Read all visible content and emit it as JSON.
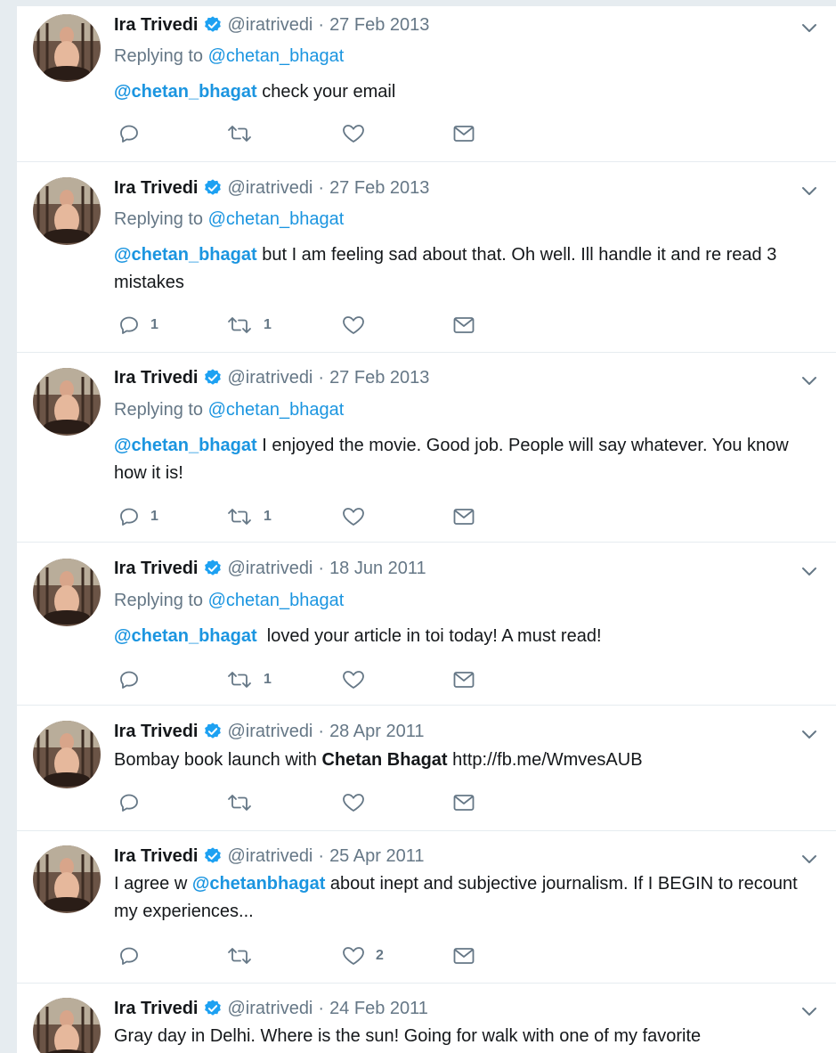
{
  "tweets": [
    {
      "name": "Ira Trivedi",
      "handle": "@iratrivedi",
      "date": "27 Feb 2013",
      "replying_prefix": "Replying to",
      "replying_to": "@chetan_bhagat",
      "mention": "@chetan_bhagat",
      "text": " check your email",
      "reply_count": "",
      "retweet_count": "",
      "like_count": ""
    },
    {
      "name": "Ira Trivedi",
      "handle": "@iratrivedi",
      "date": "27 Feb 2013",
      "replying_prefix": "Replying to",
      "replying_to": "@chetan_bhagat",
      "mention": "@chetan_bhagat",
      "text": " but I am feeling sad about that. Oh well. Ill handle it and re read 3 mistakes",
      "reply_count": "1",
      "retweet_count": "1",
      "like_count": ""
    },
    {
      "name": "Ira Trivedi",
      "handle": "@iratrivedi",
      "date": "27 Feb 2013",
      "replying_prefix": "Replying to",
      "replying_to": "@chetan_bhagat",
      "mention": "@chetan_bhagat",
      "text": " I enjoyed the movie. Good job. People will say whatever. You know how it is!",
      "reply_count": "1",
      "retweet_count": "1",
      "like_count": ""
    },
    {
      "name": "Ira Trivedi",
      "handle": "@iratrivedi",
      "date": "18 Jun 2011",
      "replying_prefix": "Replying to",
      "replying_to": "@chetan_bhagat",
      "mention": "@chetan_bhagat",
      "text": "  loved your article in toi today! A must read!",
      "reply_count": "",
      "retweet_count": "1",
      "like_count": ""
    },
    {
      "name": "Ira Trivedi",
      "handle": "@iratrivedi",
      "date": "28 Apr 2011",
      "text_before": "Bombay book launch with ",
      "bold": "Chetan Bhagat",
      "text_after": " http://fb.me/WmvesAUB",
      "reply_count": "",
      "retweet_count": "",
      "like_count": ""
    },
    {
      "name": "Ira Trivedi",
      "handle": "@iratrivedi",
      "date": "25 Apr 2011",
      "text_before": "I agree w ",
      "mention": "@chetanbhagat",
      "text_after": " about inept and subjective journalism. If I BEGIN to recount my experiences...",
      "reply_count": "",
      "retweet_count": "",
      "like_count": "2"
    },
    {
      "name": "Ira Trivedi",
      "handle": "@iratrivedi",
      "date": "24 Feb 2011",
      "text": "Gray day in Delhi. Where is the sun! Going for walk with one of my favorite"
    }
  ],
  "colors": {
    "link": "#1b95e0",
    "secondary": "#657786",
    "verified": "#1da1f2"
  },
  "icons": [
    "reply-icon",
    "retweet-icon",
    "like-icon",
    "message-icon",
    "verified-badge-icon",
    "chevron-down-icon"
  ]
}
